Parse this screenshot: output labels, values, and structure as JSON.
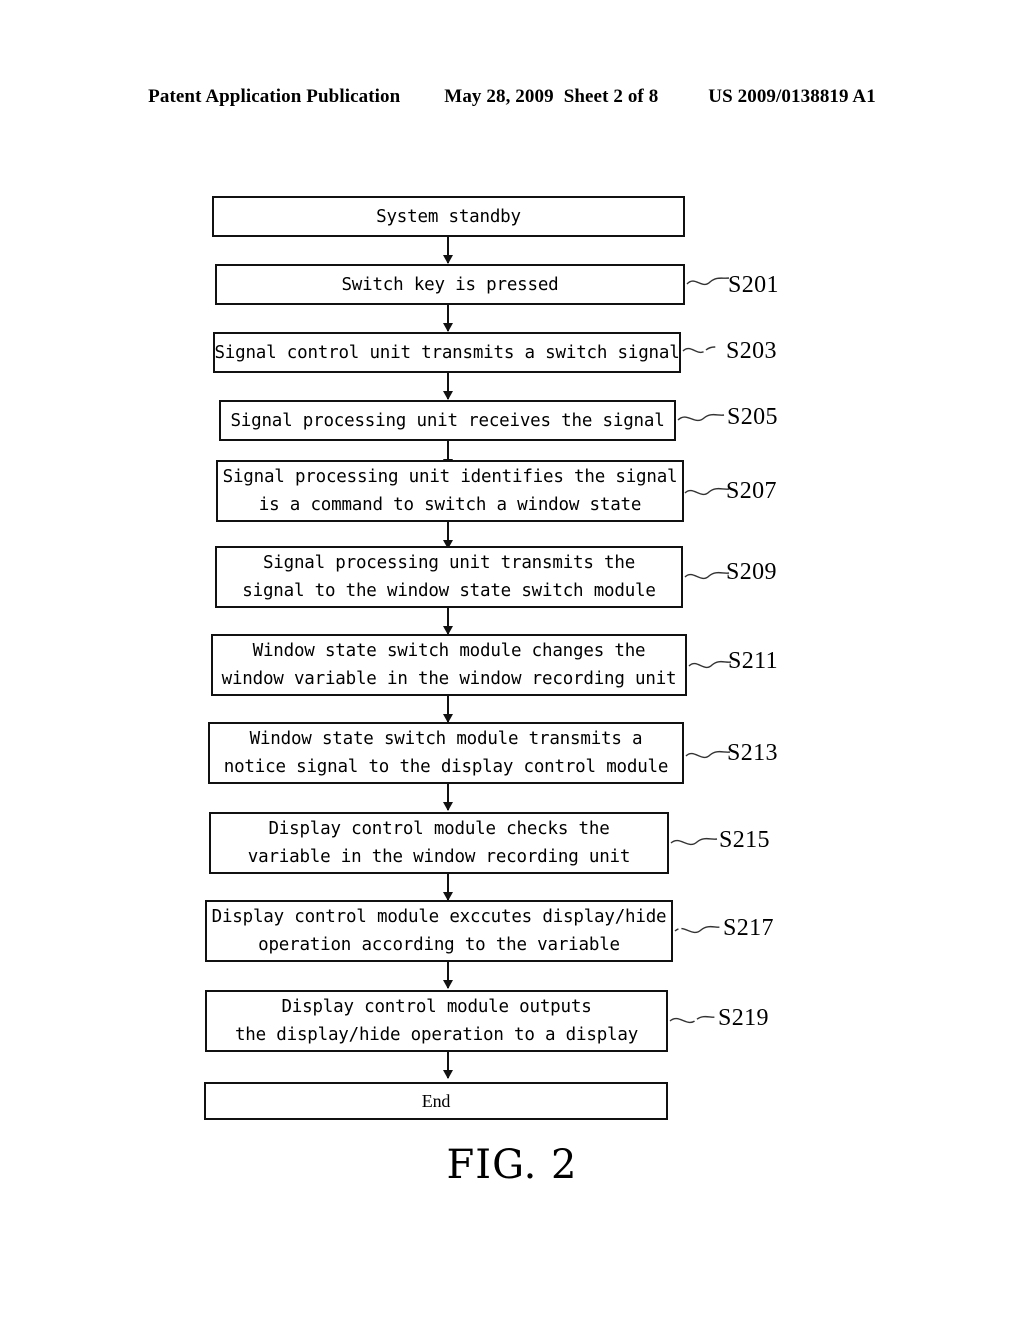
{
  "header": {
    "publication": "Patent Application Publication",
    "date": "May 28, 2009",
    "sheet": "Sheet 2 of 8",
    "patent_number": "US 2009/0138819 A1"
  },
  "figure": {
    "caption": "FIG. 2",
    "type": "flowchart"
  },
  "flowchart": {
    "start_label": "System standby",
    "end_label": "End",
    "nodes": [
      {
        "id": "start",
        "lines": [
          "System standby"
        ],
        "step": null,
        "kind": "terminator"
      },
      {
        "id": "s201",
        "lines": [
          "Switch key is pressed"
        ],
        "step": "S201",
        "kind": "process"
      },
      {
        "id": "s203",
        "lines": [
          "Signal control unit transmits a switch signal"
        ],
        "step": "S203",
        "kind": "process"
      },
      {
        "id": "s205",
        "lines": [
          "Signal processing unit receives the signal"
        ],
        "step": "S205",
        "kind": "process"
      },
      {
        "id": "s207",
        "lines": [
          "Signal processing unit identifies the signal",
          "is a command to switch a window state"
        ],
        "step": "S207",
        "kind": "process"
      },
      {
        "id": "s209",
        "lines": [
          "Signal processing unit transmits the",
          "signal to the window state switch module"
        ],
        "step": "S209",
        "kind": "process"
      },
      {
        "id": "s211",
        "lines": [
          "Window state switch module changes the",
          "window variable in the window recording unit"
        ],
        "step": "S211",
        "kind": "process"
      },
      {
        "id": "s213",
        "lines": [
          "Window state switch module transmits a",
          "notice signal to the display control module"
        ],
        "step": "S213",
        "kind": "process"
      },
      {
        "id": "s215",
        "lines": [
          "Display control module checks the",
          "variable in the window recording unit"
        ],
        "step": "S215",
        "kind": "process"
      },
      {
        "id": "s217",
        "lines": [
          "Display control module exccutes display/hide",
          "operation according to the variable"
        ],
        "step": "S217",
        "kind": "process"
      },
      {
        "id": "s219",
        "lines": [
          "Display control module outputs",
          "the display/hide operation to a display"
        ],
        "step": "S219",
        "kind": "process"
      },
      {
        "id": "end",
        "lines": [
          "End"
        ],
        "step": null,
        "kind": "terminator"
      }
    ]
  },
  "colors": {
    "ink": "#111111",
    "page": "#ffffff"
  }
}
